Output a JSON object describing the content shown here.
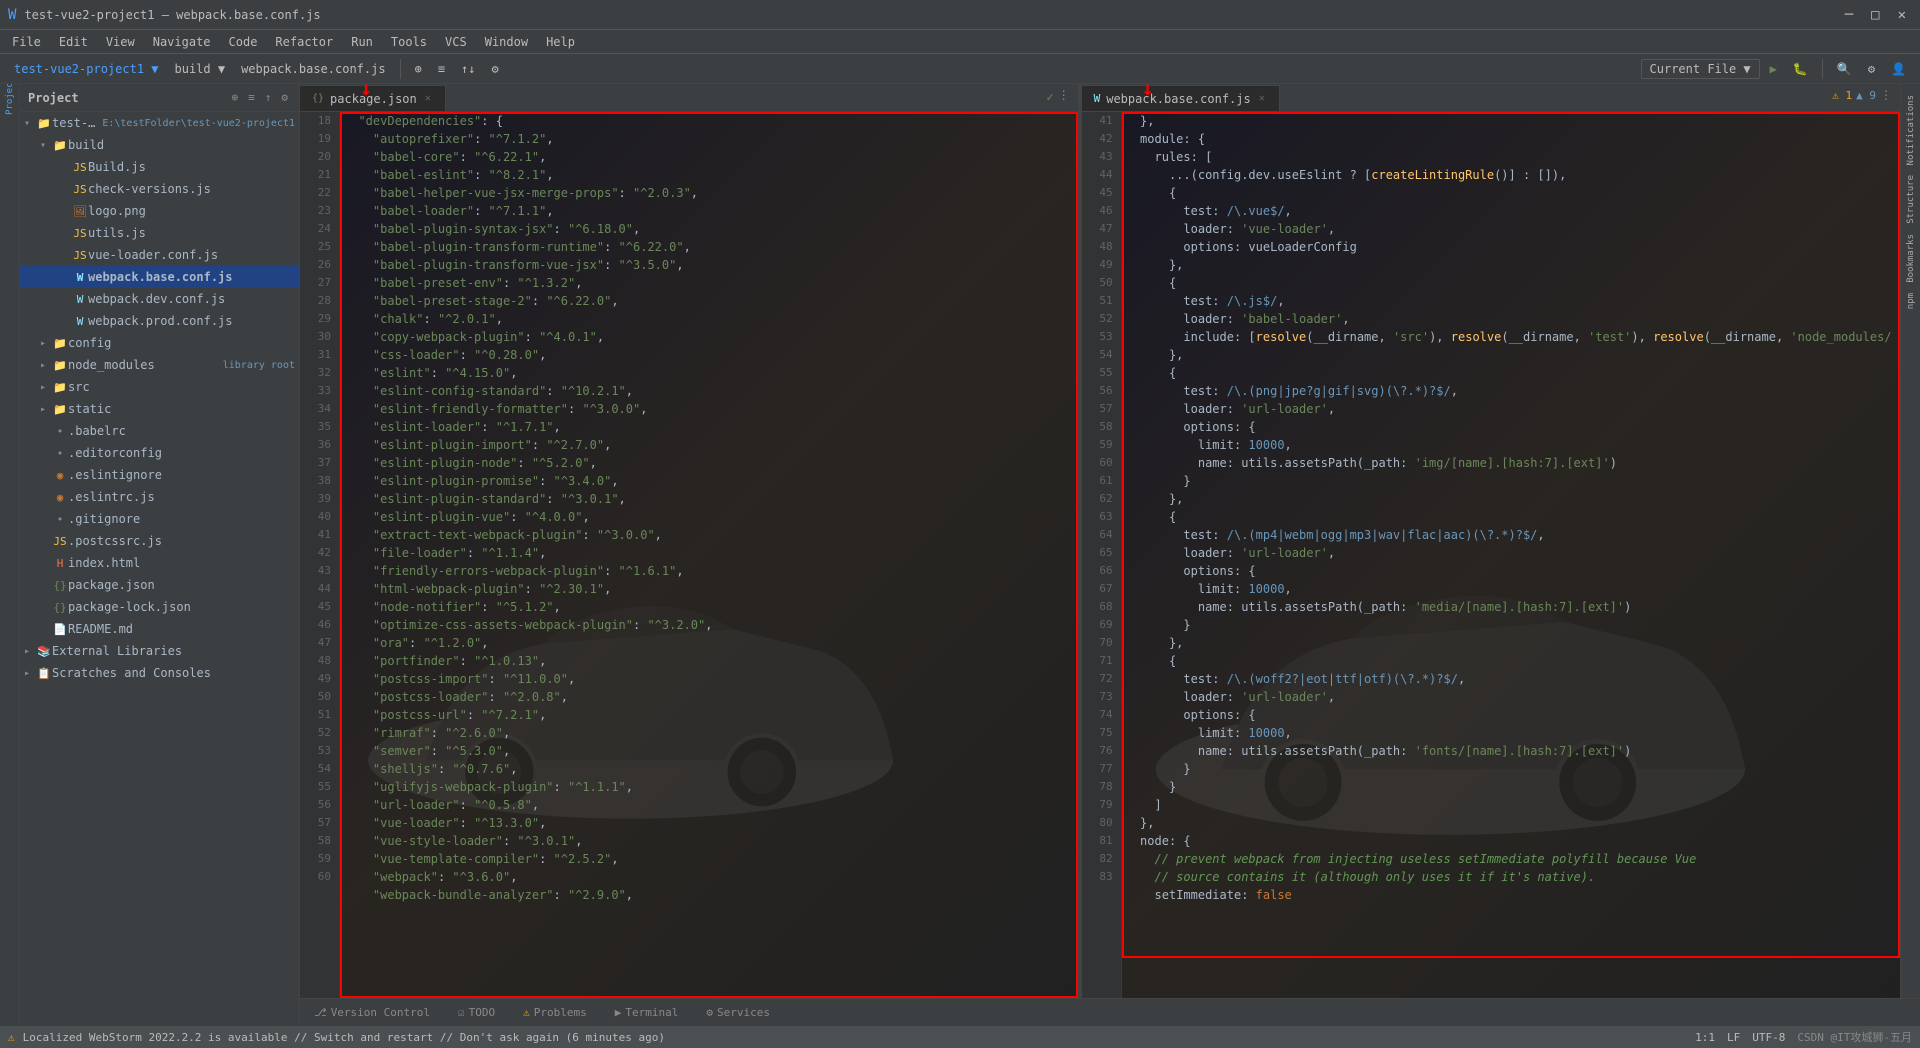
{
  "window": {
    "title": "test-vue2-project1 – webpack.base.conf.js",
    "project": "test-vue2-project1",
    "file": "webpack.base.conf.js"
  },
  "titlebar": {
    "title": "test-vue2-project1 – webpack.base.conf.js",
    "buttons": [
      "─",
      "□",
      "✕"
    ]
  },
  "menubar": {
    "items": [
      "File",
      "Edit",
      "View",
      "Navigate",
      "Code",
      "Refactor",
      "Run",
      "Tools",
      "VCS",
      "Window",
      "Help"
    ]
  },
  "toolbar": {
    "project": "test-vue2-project1",
    "build": "build",
    "file": "webpack.base.conf.js",
    "run_config": "Current File",
    "search_icon": "🔍"
  },
  "sidebar": {
    "title": "Project",
    "root": "test-vue2-project1",
    "root_path": "E:\\testFolder\\test-vue2-project1",
    "items": [
      {
        "type": "folder",
        "name": "build",
        "indent": 1,
        "open": true
      },
      {
        "type": "file",
        "name": "Build.js",
        "indent": 2,
        "color": "js"
      },
      {
        "type": "file",
        "name": "check-versions.js",
        "indent": 2,
        "color": "js"
      },
      {
        "type": "file",
        "name": "logo.png",
        "indent": 2,
        "color": "img"
      },
      {
        "type": "file",
        "name": "utils.js",
        "indent": 2,
        "color": "js"
      },
      {
        "type": "file",
        "name": "vue-loader.conf.js",
        "indent": 2,
        "color": "js"
      },
      {
        "type": "file",
        "name": "webpack.base.conf.js",
        "indent": 2,
        "color": "webpack",
        "active": true
      },
      {
        "type": "file",
        "name": "webpack.dev.conf.js",
        "indent": 2,
        "color": "webpack"
      },
      {
        "type": "file",
        "name": "webpack.prod.conf.js",
        "indent": 2,
        "color": "webpack"
      },
      {
        "type": "folder",
        "name": "config",
        "indent": 1,
        "open": false
      },
      {
        "type": "folder",
        "name": "node_modules",
        "indent": 1,
        "open": false,
        "badge": "library root"
      },
      {
        "type": "folder",
        "name": "src",
        "indent": 1,
        "open": false
      },
      {
        "type": "folder",
        "name": "static",
        "indent": 1,
        "open": false
      },
      {
        "type": "file",
        "name": ".babelrc",
        "indent": 1
      },
      {
        "type": "file",
        "name": ".editorconfig",
        "indent": 1
      },
      {
        "type": "file",
        "name": ".eslintignore",
        "indent": 1,
        "color": "eslint"
      },
      {
        "type": "file",
        "name": ".eslintrc.js",
        "indent": 1,
        "color": "eslint"
      },
      {
        "type": "file",
        "name": ".gitignore",
        "indent": 1
      },
      {
        "type": "file",
        "name": ".postcssrc.js",
        "indent": 1
      },
      {
        "type": "file",
        "name": "index.html",
        "indent": 1,
        "color": "html"
      },
      {
        "type": "file",
        "name": "package.json",
        "indent": 1,
        "color": "json"
      },
      {
        "type": "file",
        "name": "package-lock.json",
        "indent": 1,
        "color": "json"
      },
      {
        "type": "file",
        "name": "README.md",
        "indent": 1
      },
      {
        "type": "folder",
        "name": "External Libraries",
        "indent": 0,
        "icon": "📚"
      },
      {
        "type": "folder",
        "name": "Scratches and Consoles",
        "indent": 0,
        "icon": "📋"
      }
    ]
  },
  "left_editor": {
    "tab": "package.json",
    "tab_icon": "{}",
    "lines_start": 18,
    "code": [
      "  \"devDependencies\": {",
      "    \"autoprefixer\": \"^7.1.2\",",
      "    \"babel-core\": \"^6.22.1\",",
      "    \"babel-eslint\": \"^8.2.1\",",
      "    \"babel-helper-vue-jsx-merge-props\": \"^2.0.3\",",
      "    \"babel-loader\": \"^7.1.1\",",
      "    \"babel-plugin-syntax-jsx\": \"^6.18.0\",",
      "    \"babel-plugin-transform-runtime\": \"^6.22.0\",",
      "    \"babel-plugin-transform-vue-jsx\": \"^3.5.0\",",
      "    \"babel-preset-env\": \"^1.3.2\",",
      "    \"babel-preset-stage-2\": \"^6.22.0\",",
      "    \"chalk\": \"^2.0.1\",",
      "    \"copy-webpack-plugin\": \"^4.0.1\",",
      "    \"css-loader\": \"^0.28.0\",",
      "    \"eslint\": \"^4.15.0\",",
      "    \"eslint-config-standard\": \"^10.2.1\",",
      "    \"eslint-friendly-formatter\": \"^3.0.0\",",
      "    \"eslint-loader\": \"^1.7.1\",",
      "    \"eslint-plugin-import\": \"^2.7.0\",",
      "    \"eslint-plugin-node\": \"^5.2.0\",",
      "    \"eslint-plugin-promise\": \"^3.4.0\",",
      "    \"eslint-plugin-standard\": \"^3.0.1\",",
      "    \"eslint-plugin-vue\": \"^4.0.0\",",
      "    \"extract-text-webpack-plugin\": \"^3.0.0\",",
      "    \"file-loader\": \"^1.1.4\",",
      "    \"friendly-errors-webpack-plugin\": \"^1.6.1\",",
      "    \"html-webpack-plugin\": \"^2.30.1\",",
      "    \"node-notifier\": \"^5.1.2\",",
      "    \"optimize-css-assets-webpack-plugin\": \"^3.2.0\",",
      "    \"ora\": \"^1.2.0\",",
      "    \"portfinder\": \"^1.0.13\",",
      "    \"postcss-import\": \"^11.0.0\",",
      "    \"postcss-loader\": \"^2.0.8\",",
      "    \"postcss-url\": \"^7.2.1\",",
      "    \"rimraf\": \"^2.6.0\",",
      "    \"semver\": \"^5.3.0\",",
      "    \"shelljs\": \"^0.7.6\",",
      "    \"uglifyjs-webpack-plugin\": \"^1.1.1\",",
      "    \"url-loader\": \"^0.5.8\",",
      "    \"vue-loader\": \"^13.3.0\",",
      "    \"vue-style-loader\": \"^3.0.1\",",
      "    \"vue-template-compiler\": \"^2.5.2\",",
      "    \"webpack\": \"^3.6.0\",",
      "    \"webpack-bundle-analyzer\": \"^2.9.0\","
    ]
  },
  "right_editor": {
    "tab": "webpack.base.conf.js",
    "tab_icon": "W",
    "lines_start": 41,
    "code": [
      "  },",
      "  module: {",
      "    rules: [",
      "      ...(config.dev.useEslint ? [createLintingRule()] : []),",
      "      {",
      "        test: /\\.vue$/,",
      "        loader: 'vue-loader',",
      "        options: vueLoaderConfig",
      "      },",
      "      {",
      "        test: /\\.js$/,",
      "        loader: 'babel-loader',",
      "        include: [resolve(__dirname, 'src'), resolve(__dirname, 'test'), resolve(__dirname, 'node_modules/",
      "      },",
      "      {",
      "        test: /\\.(png|jpe?g|gif|svg)(\\?.*)?$/,",
      "        loader: 'url-loader',",
      "        options: {",
      "          limit: 10000,",
      "          name: utils.assetsPath(_path: 'img/[name].[hash:7].[ext]')",
      "        }",
      "      },",
      "      {",
      "        test: /\\.(mp4|webm|ogg|mp3|wav|flac|aac)(\\?.*)?$/,",
      "        loader: 'url-loader',",
      "        options: {",
      "          limit: 10000,",
      "          name: utils.assetsPath(_path: 'media/[name].[hash:7].[ext]')",
      "        }",
      "      },",
      "      {",
      "        test: /\\.(woff2?|eot|ttf|otf)(\\?.*)?$/,",
      "        loader: 'url-loader',",
      "        options: {",
      "          limit: 10000,",
      "          name: utils.assetsPath(_path: 'fonts/[name].[hash:7].[ext]')",
      "        }",
      "      }",
      "    ]",
      "  },",
      "  node: {",
      "    // prevent webpack from injecting useless setImmediate polyfill because Vue",
      "    // source contains it (although only uses it if it's native).",
      "    setImmediate: false"
    ]
  },
  "status_bar": {
    "left": "⚠ Localized WebStorm 2022.2.2 is available // Switch and restart // Don't ask again (6 minutes ago)",
    "warning_icon": "⚠",
    "version_control": "Version Control",
    "todo": "TODO",
    "problems": "Problems",
    "terminal": "Terminal",
    "services": "Services",
    "right": "1:1  LF  UTF-8  CSDN @IT攻城狮-五月",
    "line_col": "1:1",
    "encoding": "UTF-8",
    "line_ending": "LF"
  },
  "bottom_tabs": [
    {
      "icon": "⎇",
      "label": "Version Control"
    },
    {
      "icon": "☑",
      "label": "TODO"
    },
    {
      "icon": "⚠",
      "label": "Problems"
    },
    {
      "icon": "▶",
      "label": "Terminal"
    },
    {
      "icon": "⚙",
      "label": "Services"
    }
  ],
  "right_panel_tabs": [
    {
      "label": "Notifications"
    },
    {
      "label": "Structure"
    },
    {
      "label": "Bookmarks"
    },
    {
      "label": "npm"
    }
  ]
}
